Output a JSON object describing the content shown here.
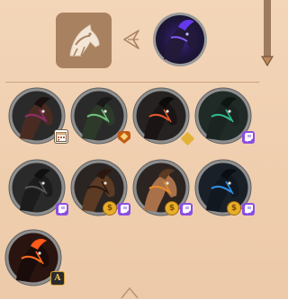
{
  "header": {
    "equipped_icon": "horse-head-icon",
    "arrow_icon": "arrow-left-icon",
    "preview_horse": {
      "name": "selected-horse-preview",
      "coat": "#1c1530",
      "accent": "#7a4bff"
    }
  },
  "colors": {
    "background": "#f1d2b4",
    "slot_bg": "#a88260",
    "ring": "#8f8f8f",
    "twitch_badge": "#8a4fe0",
    "coin_badge": "#e8ae2a"
  },
  "horses": [
    {
      "id": "horse-1",
      "coat": "#4a2b22",
      "mane": "#1a1010",
      "tack": "#8e2e6a",
      "bg": "#2a2a2a",
      "badges": [
        "calendar"
      ]
    },
    {
      "id": "horse-2",
      "coat": "#2d3a2a",
      "mane": "#1a1a1a",
      "tack": "#6fbf7a",
      "bg": "#2a2a2a",
      "badges": [
        "shield"
      ]
    },
    {
      "id": "horse-3",
      "coat": "#1a1414",
      "mane": "#0d0a0a",
      "tack": "#e0562e",
      "bg": "#262222",
      "badges": [
        "gold-diamond"
      ]
    },
    {
      "id": "horse-4",
      "coat": "#1b2420",
      "mane": "#0f1612",
      "tack": "#2fb88a",
      "bg": "#202a26",
      "badges": [
        "twitch"
      ]
    },
    {
      "id": "horse-5",
      "coat": "#1c1c1c",
      "mane": "#101010",
      "tack": "#555555",
      "bg": "#2a2a2a",
      "badges": [
        "twitch"
      ]
    },
    {
      "id": "horse-6",
      "coat": "#5c3a24",
      "mane": "#2a1810",
      "tack": "#2a1a10",
      "bg": "#2a2522",
      "badges": [
        "coin",
        "twitch"
      ]
    },
    {
      "id": "horse-7",
      "coat": "#a8714a",
      "mane": "#5a3a22",
      "tack": "#e68a2a",
      "bg": "#2c2420",
      "badges": [
        "coin",
        "twitch"
      ]
    },
    {
      "id": "horse-8",
      "coat": "#121820",
      "mane": "#0a0e14",
      "tack": "#2e8fe0",
      "bg": "#1a2028",
      "badges": [
        "coin",
        "twitch"
      ]
    },
    {
      "id": "horse-9",
      "coat": "#1a0c0a",
      "mane": "#ff5a1a",
      "tack": "#ff6a20",
      "bg": "#2a1410",
      "badges": [
        "rank"
      ]
    }
  ],
  "badge_text": {
    "coin": "$",
    "rank": "A"
  }
}
